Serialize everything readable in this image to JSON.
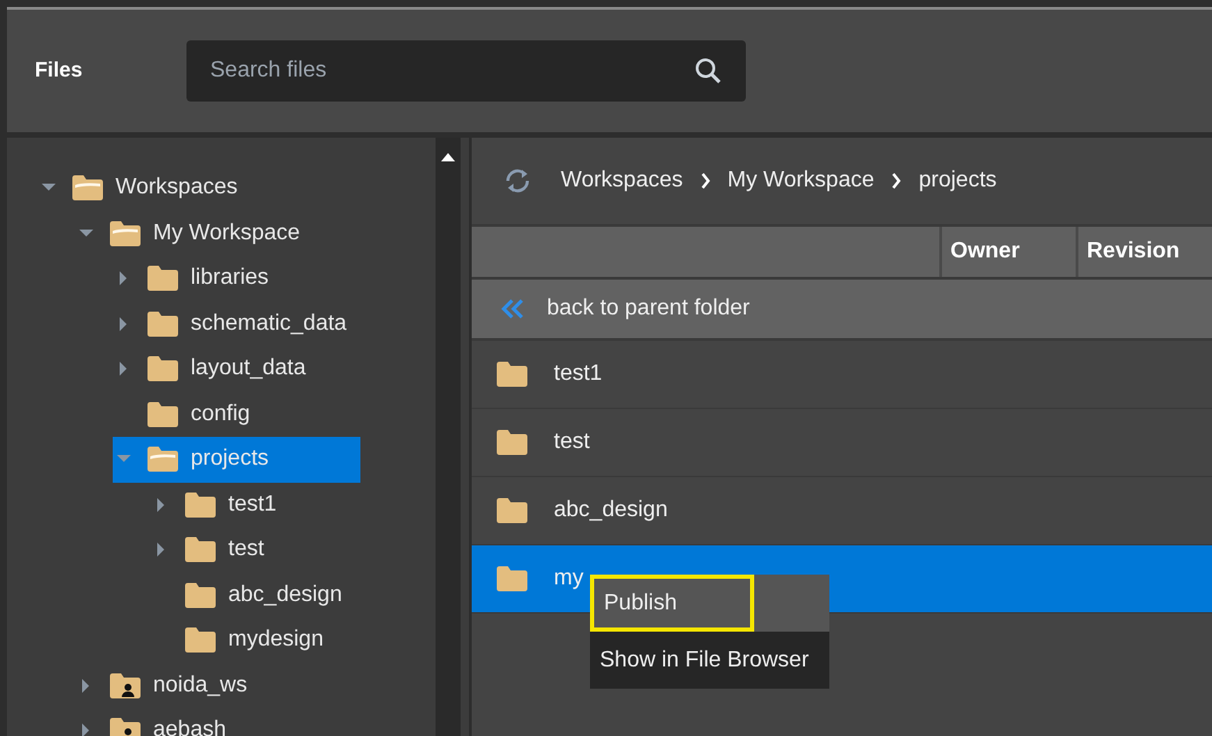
{
  "header": {
    "title": "Files",
    "search": {
      "placeholder": "Search files"
    }
  },
  "tree": [
    {
      "label": "Workspaces",
      "kind": "folder",
      "expanded": true,
      "selected": false,
      "children": [
        {
          "label": "My Workspace",
          "kind": "folder",
          "expanded": true,
          "selected": false,
          "children": [
            {
              "label": "libraries",
              "kind": "folder",
              "expanded": false,
              "selected": false
            },
            {
              "label": "schematic_data",
              "kind": "folder",
              "expanded": false,
              "selected": false
            },
            {
              "label": "layout_data",
              "kind": "folder",
              "expanded": false,
              "selected": false
            },
            {
              "label": "config",
              "kind": "folder",
              "selected": false
            },
            {
              "label": "projects",
              "kind": "folder",
              "expanded": true,
              "selected": true,
              "children": [
                {
                  "label": "test1",
                  "kind": "folder",
                  "expanded": false,
                  "selected": false
                },
                {
                  "label": "test",
                  "kind": "folder",
                  "expanded": false,
                  "selected": false
                },
                {
                  "label": "abc_design",
                  "kind": "folder",
                  "selected": false
                },
                {
                  "label": "mydesign",
                  "kind": "folder",
                  "selected": false
                }
              ]
            }
          ]
        },
        {
          "label": "noida_ws",
          "kind": "user-folder",
          "expanded": false,
          "selected": false
        },
        {
          "label": "aebash",
          "kind": "user-folder",
          "expanded": false,
          "selected": false
        }
      ]
    }
  ],
  "breadcrumb": [
    "Workspaces",
    "My Workspace",
    "projects"
  ],
  "table": {
    "columns": [
      "Owner",
      "Revision"
    ],
    "back_row": "back to parent folder",
    "rows": [
      {
        "name": "test1",
        "selected": false
      },
      {
        "name": "test",
        "selected": false
      },
      {
        "name": "abc_design",
        "selected": false
      },
      {
        "name": "my",
        "selected": true
      }
    ]
  },
  "context_menu": {
    "items": [
      {
        "label": "Publish",
        "highlighted": true
      },
      {
        "label": "Show in File Browser",
        "highlighted": false
      }
    ]
  }
}
